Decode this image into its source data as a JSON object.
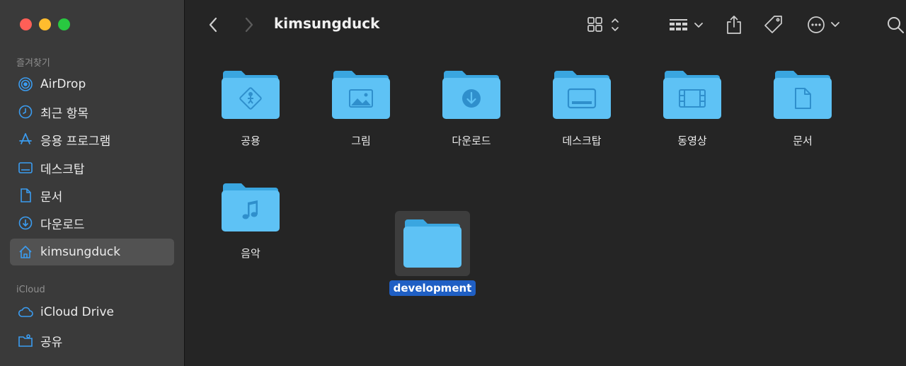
{
  "window": {
    "title": "kimsungduck"
  },
  "sidebar": {
    "favorites_label": "즐겨찾기",
    "icloud_label": "iCloud",
    "favorites": [
      {
        "label": "AirDrop",
        "icon": "airdrop-icon"
      },
      {
        "label": "최근 항목",
        "icon": "clock-icon"
      },
      {
        "label": "응용 프로그램",
        "icon": "applications-icon"
      },
      {
        "label": "데스크탑",
        "icon": "desktop-icon"
      },
      {
        "label": "문서",
        "icon": "document-icon"
      },
      {
        "label": "다운로드",
        "icon": "download-icon"
      },
      {
        "label": "kimsungduck",
        "icon": "home-icon",
        "selected": true
      }
    ],
    "icloud": [
      {
        "label": "iCloud Drive",
        "icon": "cloud-icon"
      },
      {
        "label": "공유",
        "icon": "shared-folder-icon"
      }
    ]
  },
  "files": [
    {
      "name": "공용",
      "glyph": "public"
    },
    {
      "name": "그림",
      "glyph": "pictures"
    },
    {
      "name": "다운로드",
      "glyph": "downloads"
    },
    {
      "name": "데스크탑",
      "glyph": "desktop"
    },
    {
      "name": "동영상",
      "glyph": "movies"
    },
    {
      "name": "문서",
      "glyph": "documents"
    },
    {
      "name": "음악",
      "glyph": "music"
    },
    {
      "name": "development",
      "glyph": "plain",
      "selected": true
    }
  ],
  "colors": {
    "folder": "#5ec2f5",
    "folder_dark": "#3aa6e0",
    "selection": "#1f5fc4"
  }
}
